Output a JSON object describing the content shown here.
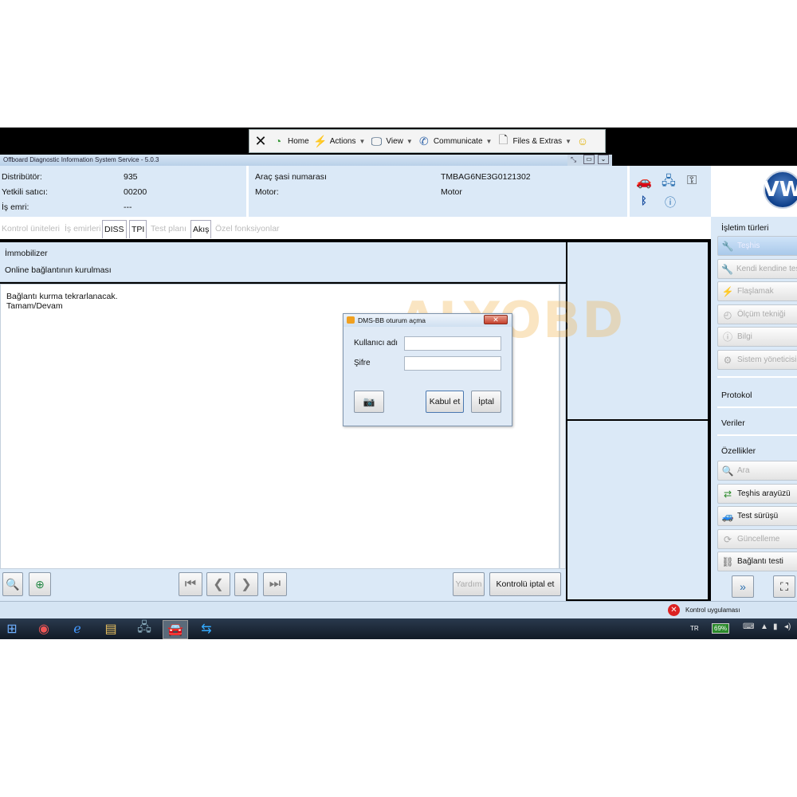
{
  "toolbar": {
    "home": "Home",
    "actions": "Actions",
    "view": "View",
    "communicate": "Communicate",
    "files": "Files & Extras"
  },
  "window": {
    "title": "Offboard Diagnostic Information System Service - 5.0.3"
  },
  "header": {
    "distributor_label": "Distribütör:",
    "distributor_value": "935",
    "dealer_label": "Yetkili satıcı:",
    "dealer_value": "00200",
    "order_label": "İş emri:",
    "order_value": "---",
    "vin_label": "Araç şasi numarası",
    "vin_value": "TMBAG6NE3G0121302",
    "engine_label": "Motor:",
    "engine_value": "Motor"
  },
  "brand": {
    "logo": "VW"
  },
  "tabs": [
    {
      "label": "Kontrol üniteleri"
    },
    {
      "label": "İş emirleri"
    },
    {
      "label": "DISS"
    },
    {
      "label": "TPI"
    },
    {
      "label": "Test planı"
    },
    {
      "label": "Akış"
    },
    {
      "label": "Özel fonksiyonlar"
    }
  ],
  "content": {
    "title": "İmmobilizer",
    "subtitle": "Online bağlantının kurulması",
    "line1": "Bağlantı kurma tekrarlanacak.",
    "line2": "Tamam/Devam"
  },
  "bottombar": {
    "help": "Yardım",
    "cancel_check": "Kontrolü iptal et"
  },
  "dialog": {
    "title": "DMS-BB oturum açma",
    "username_label": "Kullanıcı adı",
    "password_label": "Şifre",
    "accept": "Kabul et",
    "cancel": "İptal",
    "username_value": "",
    "password_value": ""
  },
  "sidebar": {
    "modes_heading": "İşletim türleri",
    "modes": [
      {
        "label": "Teşhis"
      },
      {
        "label": "Kendi kendine teşhis"
      },
      {
        "label": "Flaşlamak"
      },
      {
        "label": "Ölçüm tekniği"
      },
      {
        "label": "Bilgi"
      },
      {
        "label": "Sistem yöneticisi"
      }
    ],
    "protocol": "Protokol",
    "data": "Veriler",
    "features_heading": "Özellikler",
    "features": [
      {
        "label": "Ara"
      },
      {
        "label": "Teşhis arayüzü"
      },
      {
        "label": "Test sürüşü"
      },
      {
        "label": "Güncelleme"
      },
      {
        "label": "Bağlantı testi"
      }
    ]
  },
  "status": {
    "text": "Kontrol uygulaması"
  },
  "taskbar": {
    "lang": "TR",
    "battery": "69%"
  },
  "watermark": {
    "text": "ALYOBD"
  },
  "colors": {
    "panel": "#dbe9f7",
    "accent_orange": "#f0a020",
    "error_red": "#d22"
  }
}
